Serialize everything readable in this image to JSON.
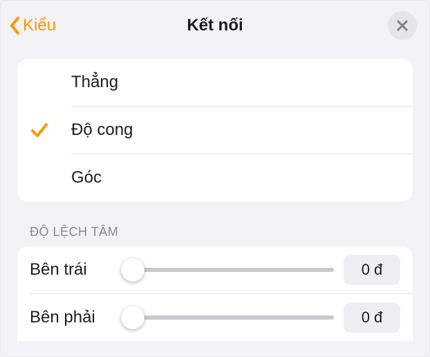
{
  "nav": {
    "back_label": "Kiểu",
    "title": "Kết nối"
  },
  "connection": {
    "options": [
      {
        "label": "Thẳng",
        "selected": false
      },
      {
        "label": "Độ cong",
        "selected": true
      },
      {
        "label": "Góc",
        "selected": false
      }
    ]
  },
  "offset": {
    "header": "ĐỘ LỆCH TÂM",
    "rows": [
      {
        "label": "Bên trái",
        "value_display": "0 đ",
        "value": 0
      },
      {
        "label": "Bên phải",
        "value_display": "0 đ",
        "value": 0
      }
    ]
  },
  "colors": {
    "accent": "#ff9500"
  }
}
